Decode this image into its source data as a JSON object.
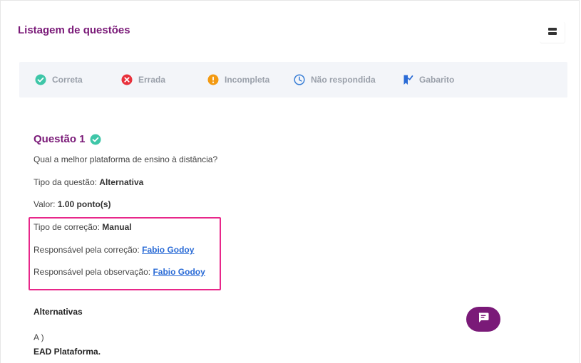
{
  "header": {
    "title": "Listagem de questões"
  },
  "legend": {
    "items": [
      {
        "label": "Correta",
        "icon": "check-circle-icon",
        "color": "#3ec6a8"
      },
      {
        "label": "Errada",
        "icon": "x-circle-icon",
        "color": "#e8313c"
      },
      {
        "label": "Incompleta",
        "icon": "exclamation-circle-icon",
        "color": "#f39a12"
      },
      {
        "label": "Não respondida",
        "icon": "clock-icon",
        "color": "#3a7fd6"
      },
      {
        "label": "Gabarito",
        "icon": "bookmark-check-icon",
        "color": "#2a6bd6"
      }
    ]
  },
  "question": {
    "title": "Questão 1",
    "text": "Qual a melhor plataforma de ensino à distância?",
    "type_label": "Tipo da questão:",
    "type_value": "Alternativa",
    "value_label": "Valor:",
    "value_value": "1.00 ponto(s)",
    "correction_type_label": "Tipo de correção:",
    "correction_type_value": "Manual",
    "corrector_label": "Responsável pela correção:",
    "corrector_value": "Fabio Godoy",
    "observer_label": "Responsável pela observação:",
    "observer_value": "Fabio Godoy"
  },
  "alternatives": {
    "title": "Alternativas",
    "items": [
      {
        "letter": "A )",
        "text": "EAD Plataforma."
      }
    ]
  },
  "colors": {
    "brand": "#7a1a78",
    "highlight": "#e8278a",
    "link": "#2a6bd6"
  }
}
